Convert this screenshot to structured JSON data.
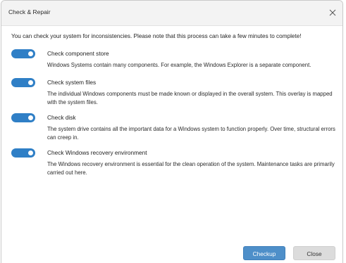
{
  "window": {
    "title": "Check & Repair",
    "close_icon": "close-icon"
  },
  "intro": "You can check your system for inconsistencies. Please note that this process can take a few minutes to complete!",
  "options": [
    {
      "label": "Check component store",
      "description": "Windows Systems contain many components. For example, the Windows Explorer is a separate component.",
      "enabled": true
    },
    {
      "label": "Check system files",
      "description": "The individual Windows components must be made known or displayed in the overall system. This overlay is mapped with the system files.",
      "enabled": true
    },
    {
      "label": "Check disk",
      "description": "The system drive contains all the important data for a Windows system to function properly. Over time, structural errors can creep in.",
      "enabled": true
    },
    {
      "label": "Check Windows recovery environment",
      "description": "The Windows recovery environment is essential for the clean operation of the system. Maintenance tasks are primarily carried out here.",
      "enabled": true
    }
  ],
  "buttons": {
    "checkup": "Checkup",
    "close": "Close"
  },
  "colors": {
    "accent": "#2f7fc6",
    "primary_button": "#4e8fc9",
    "secondary_button": "#dcdcdc"
  }
}
